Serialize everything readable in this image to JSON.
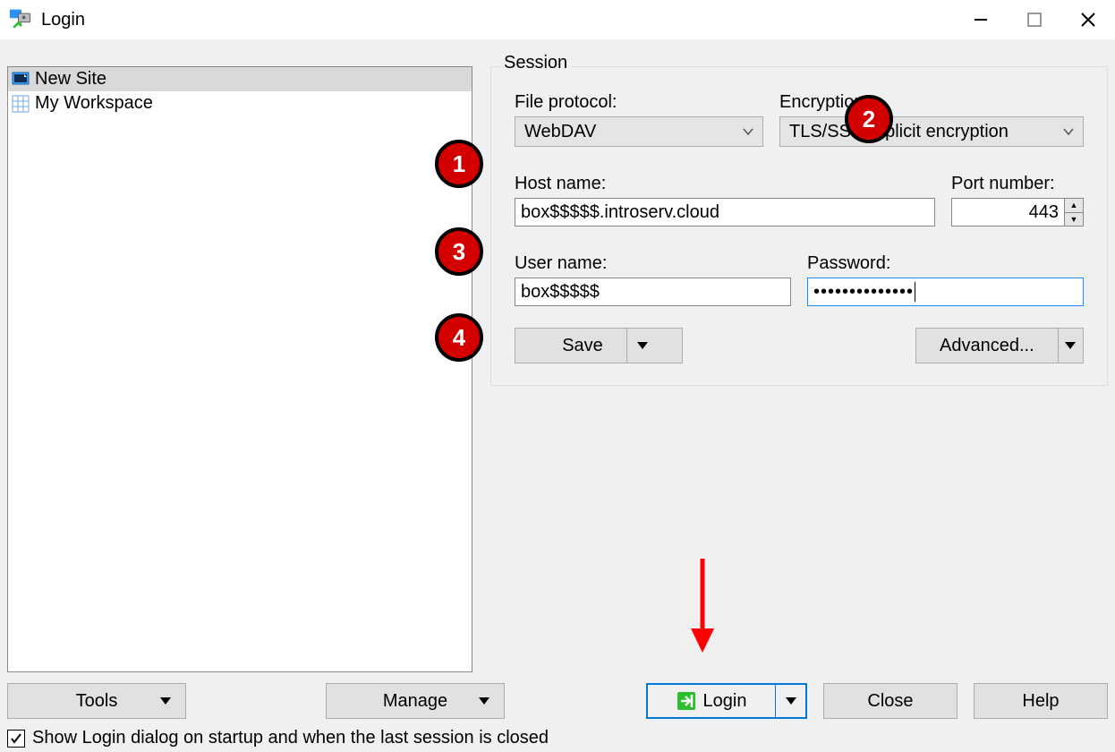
{
  "titlebar": {
    "title": "Login"
  },
  "sidebar": {
    "items": [
      {
        "label": "New Site",
        "selected": true,
        "icon": "monitor"
      },
      {
        "label": "My Workspace",
        "selected": false,
        "icon": "grid"
      }
    ]
  },
  "session": {
    "legend": "Session",
    "file_protocol_label": "File protocol:",
    "file_protocol_value": "WebDAV",
    "encryption_label": "Encryption:",
    "encryption_value": "TLS/SSL Implicit encryption",
    "host_label": "Host name:",
    "host_value": "box$$$$$.introserv.cloud",
    "port_label": "Port number:",
    "port_value": "443",
    "user_label": "User name:",
    "user_value": "box$$$$$",
    "password_label": "Password:",
    "password_mask": "••••••••••••••",
    "save_label": "Save",
    "advanced_label": "Advanced..."
  },
  "bottom": {
    "tools_label": "Tools",
    "manage_label": "Manage",
    "login_label": "Login",
    "close_label": "Close",
    "help_label": "Help"
  },
  "checkbox": {
    "checked": true,
    "label": "Show Login dialog on startup and when the last session is closed"
  },
  "callouts": [
    "1",
    "2",
    "3",
    "4"
  ]
}
